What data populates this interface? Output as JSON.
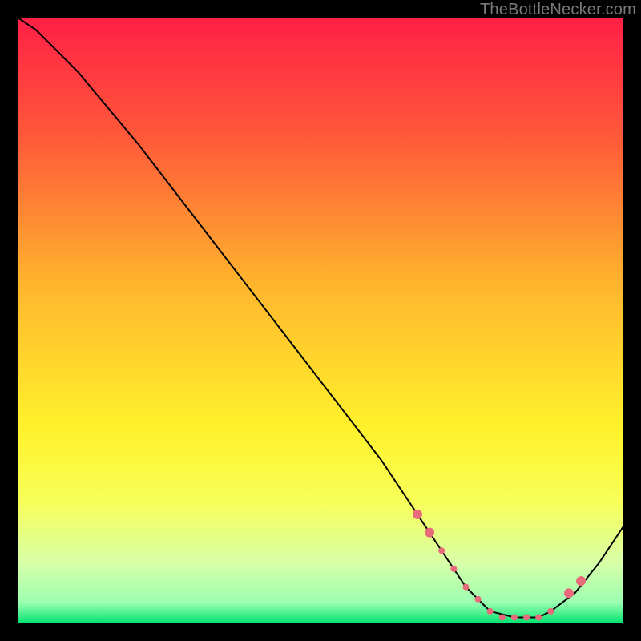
{
  "attribution": "TheBottleNecker.com",
  "chart_data": {
    "type": "line",
    "title": "",
    "xlabel": "",
    "ylabel": "",
    "xlim": [
      0,
      100
    ],
    "ylim": [
      0,
      100
    ],
    "background_gradient": {
      "stops": [
        {
          "pos": 0.0,
          "color": "#ff1f46"
        },
        {
          "pos": 0.2,
          "color": "#ff5a39"
        },
        {
          "pos": 0.45,
          "color": "#ffb82d"
        },
        {
          "pos": 0.68,
          "color": "#fff22b"
        },
        {
          "pos": 0.8,
          "color": "#f7ff59"
        },
        {
          "pos": 0.9,
          "color": "#d8ffa8"
        },
        {
          "pos": 0.965,
          "color": "#9cffb1"
        },
        {
          "pos": 1.0,
          "color": "#00e36f"
        }
      ]
    },
    "series": [
      {
        "name": "curve",
        "stroke": "#000000",
        "stroke_width": 2,
        "x": [
          0,
          3,
          6,
          10,
          20,
          30,
          40,
          50,
          60,
          66,
          70,
          74,
          78,
          82,
          86,
          88,
          92,
          96,
          100
        ],
        "y": [
          100,
          98,
          95,
          91,
          79,
          66,
          53,
          40,
          27,
          18,
          12,
          6,
          2,
          1,
          1,
          2,
          5,
          10,
          16
        ]
      }
    ],
    "markers": {
      "name": "valley-dots",
      "color": "#e96a7b",
      "radius_small": 4,
      "radius_large": 6,
      "points": [
        {
          "x": 66,
          "y": 18,
          "r": "large"
        },
        {
          "x": 68,
          "y": 15,
          "r": "large"
        },
        {
          "x": 70,
          "y": 12,
          "r": "small"
        },
        {
          "x": 72,
          "y": 9,
          "r": "small"
        },
        {
          "x": 74,
          "y": 6,
          "r": "small"
        },
        {
          "x": 76,
          "y": 4,
          "r": "small"
        },
        {
          "x": 78,
          "y": 2,
          "r": "small"
        },
        {
          "x": 80,
          "y": 1,
          "r": "small"
        },
        {
          "x": 82,
          "y": 1,
          "r": "small"
        },
        {
          "x": 84,
          "y": 1,
          "r": "small"
        },
        {
          "x": 86,
          "y": 1,
          "r": "small"
        },
        {
          "x": 88,
          "y": 2,
          "r": "small"
        },
        {
          "x": 91,
          "y": 5,
          "r": "large"
        },
        {
          "x": 93,
          "y": 7,
          "r": "large"
        }
      ]
    }
  }
}
